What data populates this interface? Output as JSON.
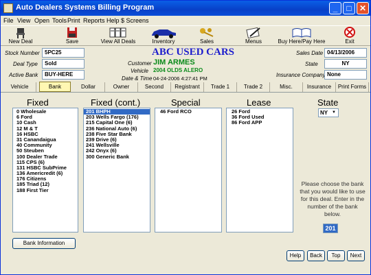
{
  "window": {
    "title": "Auto Dealers Systems Billing Program"
  },
  "menu": [
    "File",
    "View",
    "Open",
    "Tools",
    "Print",
    "Reports",
    "Help",
    "$ Screens"
  ],
  "toolbar": [
    {
      "label": "New Deal",
      "icon": "chair-icon"
    },
    {
      "label": "Save",
      "icon": "save-icon"
    },
    {
      "label": "View All Deals",
      "icon": "view-deals-icon"
    },
    {
      "label": "Inventory",
      "icon": "car-icon"
    },
    {
      "label": "Sales",
      "icon": "keys-icon"
    },
    {
      "label": "Menus",
      "icon": "pen-paper-icon"
    },
    {
      "label": "Buy Here/Pay Here",
      "icon": "book-icon"
    },
    {
      "label": "Exit",
      "icon": "exit-icon"
    }
  ],
  "deal": {
    "stock_label": "Stock Number",
    "stock_value": "5PC25",
    "type_label": "Deal Type",
    "type_value": "Sold",
    "bank_label": "Active Bank",
    "bank_value": "BUY-HERE",
    "sales_date_label": "Sales Date",
    "sales_date_value": "04/13/2006",
    "state_label": "State",
    "state_value": "NY",
    "insurance_label": "Insurance Company",
    "insurance_value": "None"
  },
  "dealer": {
    "name": "ABC USED CARS",
    "customer_label": "Customer",
    "customer_value": "JIM ARMES",
    "vehicle_label": "Vehicle",
    "vehicle_value": "2004 OLDS ALERO",
    "datetime_label": "Date & Time",
    "datetime_value": "04-24-2006  4:27:41 PM"
  },
  "tabs": [
    "Vehicle",
    "Bank",
    "Dollar",
    "Owner",
    "Second",
    "Registrant",
    "Trade 1",
    "Trade 2",
    "Misc.",
    "Insurance",
    "Print Forms"
  ],
  "active_tab": "Bank",
  "columns": {
    "fixed": {
      "title": "Fixed",
      "items": [
        "0  Wholesale",
        "6  Ford",
        "10  Cash",
        "12  M & T",
        "16  HSBC",
        "31  Canandaigua",
        "40  Community",
        "50  Steuben",
        "100  Dealer Trade",
        "115  CPS (6)",
        "131  HSBC SubPrime",
        "136  Americredit (6)",
        "176  Citizens",
        "185  Triad (12)",
        "188  First Tier"
      ]
    },
    "fixed_cont": {
      "title": "Fixed (cont.)",
      "items": [
        "201  BHPH",
        "203  Wells Fargo (176)",
        "215  Capital One (6)",
        "236  National Auto (6)",
        "238  Five Star Bank",
        "239  Drive (6)",
        "241  Wellsville",
        "242  Onyx (6)",
        "300  Generic Bank"
      ],
      "selected_index": 0
    },
    "special": {
      "title": "Special",
      "items": [
        "46  Ford RCO"
      ]
    },
    "lease": {
      "title": "Lease",
      "items": [
        "26  Ford",
        "36  Ford Used",
        "86  Ford APP"
      ]
    },
    "state": {
      "title": "State",
      "value": "NY"
    }
  },
  "hint": "Please choose the bank that you would like to use for this deal. Enter in the number of the bank below.",
  "bank_entry": "201",
  "buttons": {
    "bank_info": "Bank Information",
    "help": "Help",
    "back": "Back",
    "top": "Top",
    "next": "Next"
  }
}
